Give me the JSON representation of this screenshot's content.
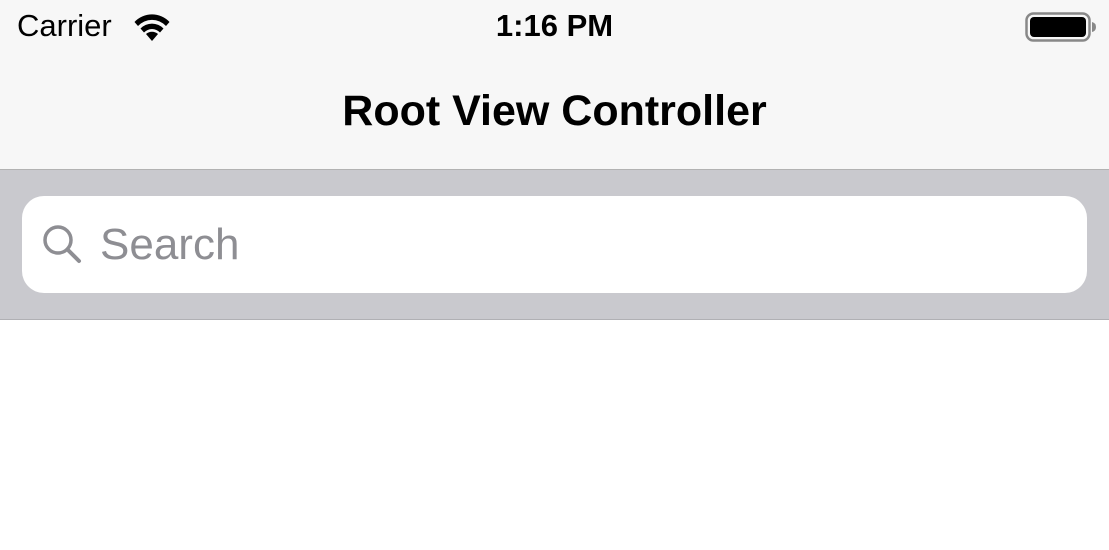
{
  "status_bar": {
    "carrier": "Carrier",
    "time": "1:16 PM",
    "wifi_icon": "wifi-icon",
    "battery_icon": "battery-icon"
  },
  "nav_bar": {
    "title": "Root View Controller"
  },
  "search": {
    "placeholder": "Search",
    "value": "",
    "icon": "search-icon"
  },
  "colors": {
    "bar_background": "#f7f7f7",
    "search_bar_background": "#c9c9ce",
    "placeholder": "#8e8e93"
  }
}
